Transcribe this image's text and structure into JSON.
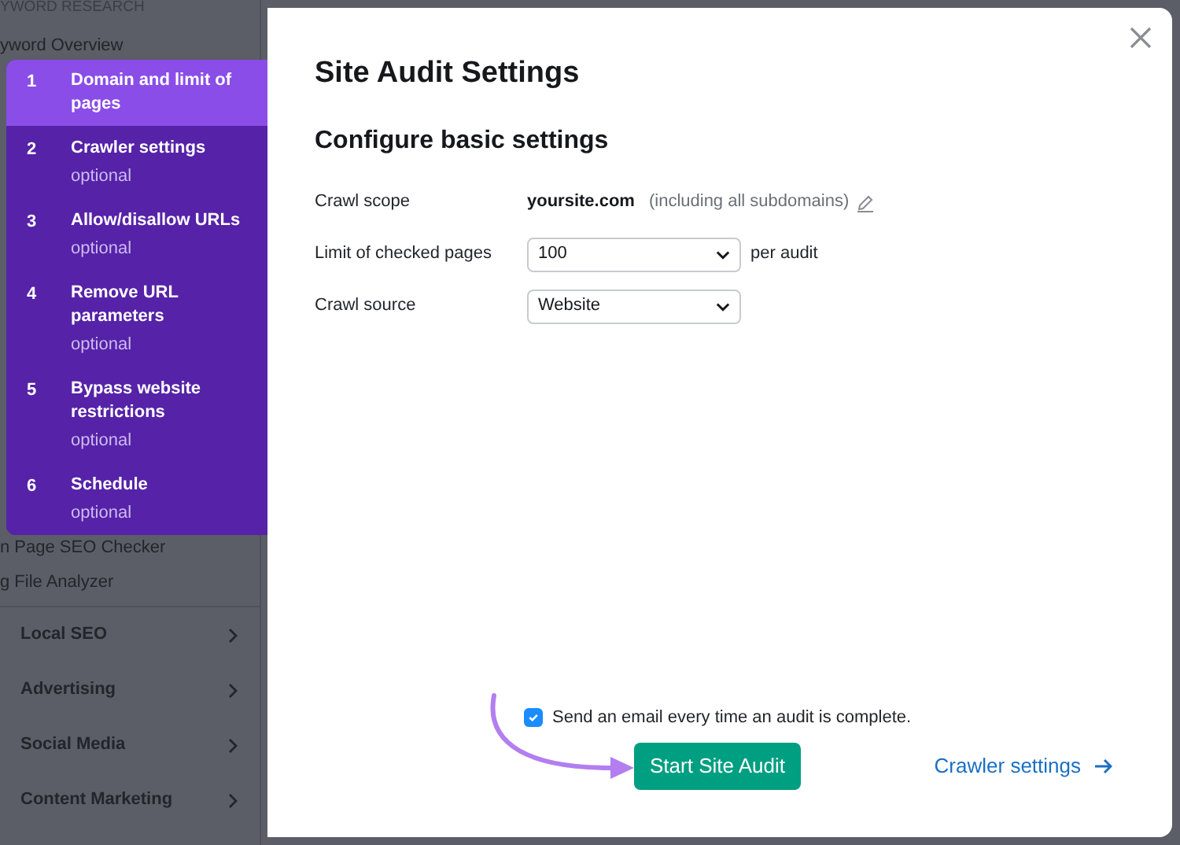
{
  "sidebar": {
    "heading": "YWORD RESEARCH",
    "top_items": [
      "yword Overview"
    ],
    "lower_items": [
      "n Page SEO Checker",
      "g File Analyzer"
    ],
    "sections": [
      {
        "label": "Local SEO"
      },
      {
        "label": "Advertising"
      },
      {
        "label": "Social Media"
      },
      {
        "label": "Content Marketing"
      }
    ]
  },
  "steps": [
    {
      "number": "1",
      "title": "Domain and limit of pages",
      "selected": true
    },
    {
      "number": "2",
      "title": "Crawler settings",
      "note": "optional",
      "selected": false
    },
    {
      "number": "3",
      "title": "Allow/disallow URLs",
      "note": "optional",
      "selected": false
    },
    {
      "number": "4",
      "title": "Remove URL parameters",
      "note": "optional",
      "selected": false
    },
    {
      "number": "5",
      "title": "Bypass website restrictions",
      "note": "optional",
      "selected": false
    },
    {
      "number": "6",
      "title": "Schedule",
      "note": "optional",
      "selected": false
    }
  ],
  "dialog": {
    "title": "Site Audit Settings",
    "subtitle": "Configure basic settings",
    "rows": [
      {
        "kind": "text",
        "label": "Crawl scope",
        "value": "yoursite.com",
        "hint": "(including all subdomains)"
      },
      {
        "kind": "select",
        "label": "Limit of checked pages",
        "value": "100",
        "suffix": "per audit"
      },
      {
        "kind": "select",
        "label": "Crawl source",
        "value": "Website"
      }
    ],
    "email_checkbox": {
      "label": "Send an email every time an audit is complete.",
      "checked": true
    },
    "start_button": "Start Site Audit",
    "link": "Crawler settings"
  }
}
